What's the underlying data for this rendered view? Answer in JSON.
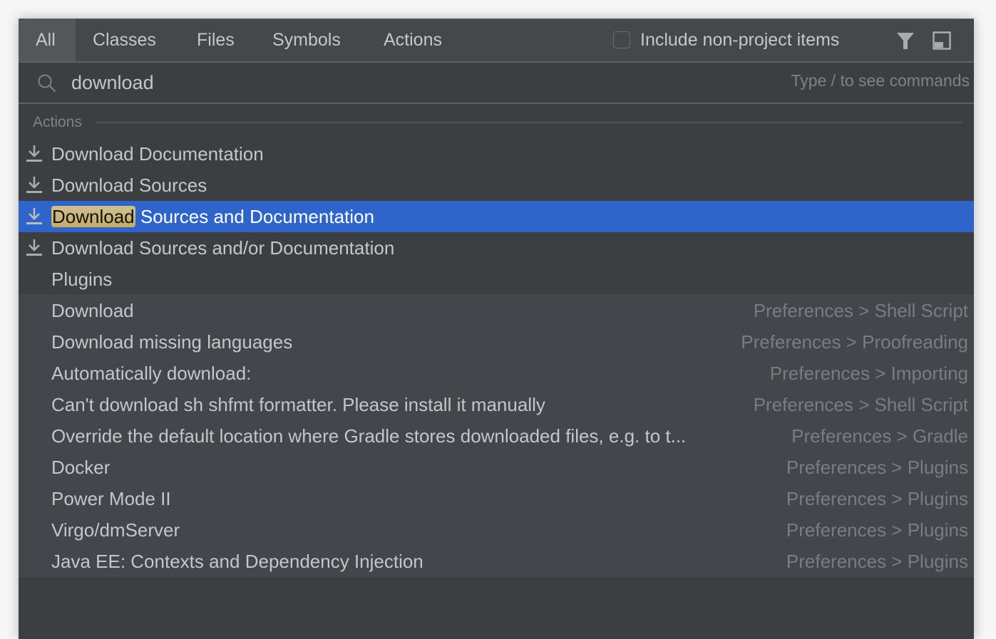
{
  "tabs": [
    {
      "label": "All",
      "active": true
    },
    {
      "label": "Classes",
      "active": false
    },
    {
      "label": "Files",
      "active": false
    },
    {
      "label": "Symbols",
      "active": false
    },
    {
      "label": "Actions",
      "active": false
    }
  ],
  "header": {
    "include_non_project_label": "Include non-project items",
    "include_non_project_checked": false,
    "filter_icon": "filter-icon",
    "pin_icon": "pin-window-icon"
  },
  "search": {
    "value": "download",
    "hint": "Type / to see commands",
    "icon": "search-icon"
  },
  "section": {
    "title": "Actions"
  },
  "actions": [
    {
      "label": "Download Documentation",
      "icon": "download-icon"
    },
    {
      "label": "Download Sources",
      "icon": "download-icon"
    },
    {
      "match": "Download",
      "rest": " Sources and Documentation",
      "icon": "download-icon",
      "selected": true
    },
    {
      "label": "Download Sources and/or Documentation",
      "icon": "download-icon"
    },
    {
      "label": "Plugins"
    }
  ],
  "settings": [
    {
      "label": "Download",
      "hint": "Preferences > Shell Script"
    },
    {
      "label": "Download missing languages",
      "hint": "Preferences > Proofreading"
    },
    {
      "label": "Automatically download:",
      "hint": "Preferences > Importing"
    },
    {
      "label": "Can't download sh shfmt formatter. Please install it manually",
      "hint": "Preferences > Shell Script"
    },
    {
      "label": "Override the default location where Gradle stores downloaded files, e.g. to t...",
      "hint": "Preferences > Gradle"
    },
    {
      "label": "Docker",
      "hint": "Preferences > Plugins"
    },
    {
      "label": "Power Mode II",
      "hint": "Preferences > Plugins"
    },
    {
      "label": "Virgo/dmServer",
      "hint": "Preferences > Plugins"
    },
    {
      "label": "Java EE: Contexts and Dependency Injection",
      "hint": "Preferences > Plugins"
    }
  ],
  "colors": {
    "selection": "#2f65ca",
    "match_highlight": "#c8b572"
  }
}
